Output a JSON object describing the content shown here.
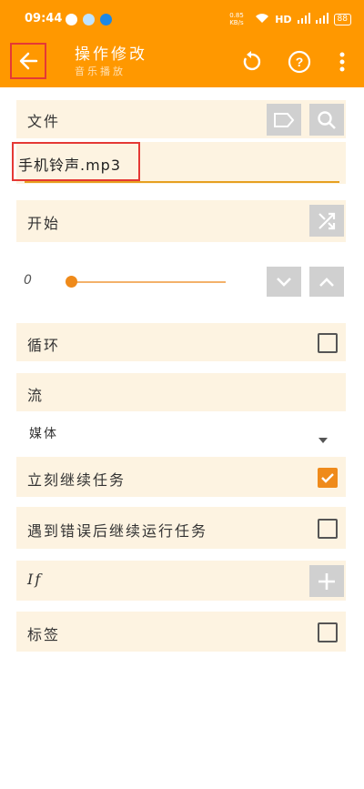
{
  "status": {
    "time": "09:44",
    "network": "0.85 KB/s",
    "hd": "HD",
    "battery": "88"
  },
  "appbar": {
    "title": "操作修改",
    "subtitle": "音乐播放"
  },
  "file": {
    "label": "文件",
    "value": "手机铃声.mp3"
  },
  "start": {
    "label": "开始"
  },
  "seek": {
    "value": "0",
    "level": 0
  },
  "loop": {
    "label": "循环",
    "checked": false
  },
  "stream": {
    "label": "流",
    "selected": "媒体"
  },
  "continue_immediately": {
    "label": "立刻继续任务",
    "checked": true
  },
  "continue_on_error": {
    "label": "遇到错误后继续运行任务",
    "checked": false
  },
  "if": {
    "label": "If"
  },
  "tag": {
    "label": "标签",
    "checked": false
  },
  "colors": {
    "accent": "#ff9800",
    "row_bg": "#fdf3e1",
    "highlight": "#e53935"
  }
}
